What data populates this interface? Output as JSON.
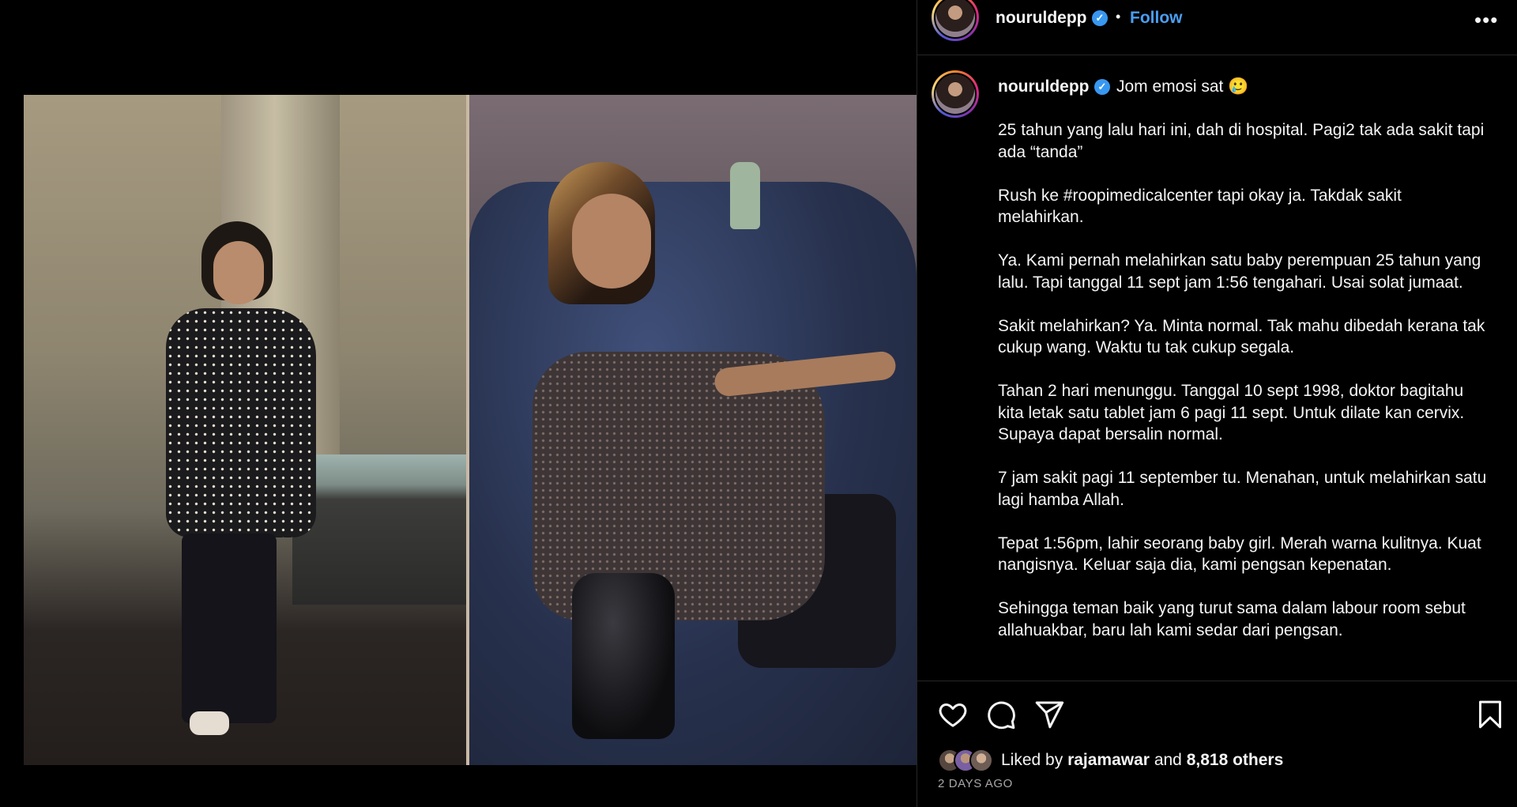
{
  "post": {
    "username": "nouruldepp",
    "follow_label": "Follow",
    "separator": "•",
    "more_label": "•••",
    "verified_badge": "check-icon",
    "caption_lead": "Jom emosi sat 🥲",
    "caption_paragraphs": [
      "25 tahun yang lalu hari ini, dah di hospital. Pagi2 tak ada sakit tapi ada “tanda”",
      "Rush ke #roopimedicalcenter tapi okay ja. Takdak sakit melahirkan.",
      "Ya. Kami pernah melahirkan satu baby perempuan 25 tahun yang lalu. Tapi tanggal 11 sept jam 1:56 tengahari. Usai solat jumaat.",
      "Sakit melahirkan? Ya. Minta normal. Tak mahu dibedah kerana tak cukup wang. Waktu tu tak cukup segala.",
      "Tahan 2 hari menunggu. Tanggal 10 sept 1998, doktor bagitahu kita letak satu tablet jam 6 pagi 11 sept. Untuk dilate kan cervix. Supaya dapat bersalin normal.",
      "7 jam sakit pagi 11 september tu. Menahan, untuk melahirkan satu lagi hamba Allah.",
      "Tepat 1:56pm, lahir seorang baby girl. Merah warna kulitnya. Kuat nangisnya. Keluar saja dia, kami pengsan kepenatan.",
      "Sehingga teman baik yang turut sama dalam labour room sebut allahuakbar, baru lah kami sedar dari pengsan."
    ],
    "likes": {
      "prefix": "Liked by",
      "user": "rajamawar",
      "conjunction": "and",
      "others": "8,818 others"
    },
    "date": "2 DAYS AGO"
  },
  "icons": {
    "like": "heart-icon",
    "comment": "comment-icon",
    "share": "paper-plane-icon",
    "save": "bookmark-icon",
    "more": "more-horizontal-icon"
  },
  "colors": {
    "background": "#000000",
    "text": "#f5f5f5",
    "follow": "#4a9ef1",
    "verified": "#3897f0",
    "muted": "#a8a8a8",
    "divider": "#262626"
  }
}
